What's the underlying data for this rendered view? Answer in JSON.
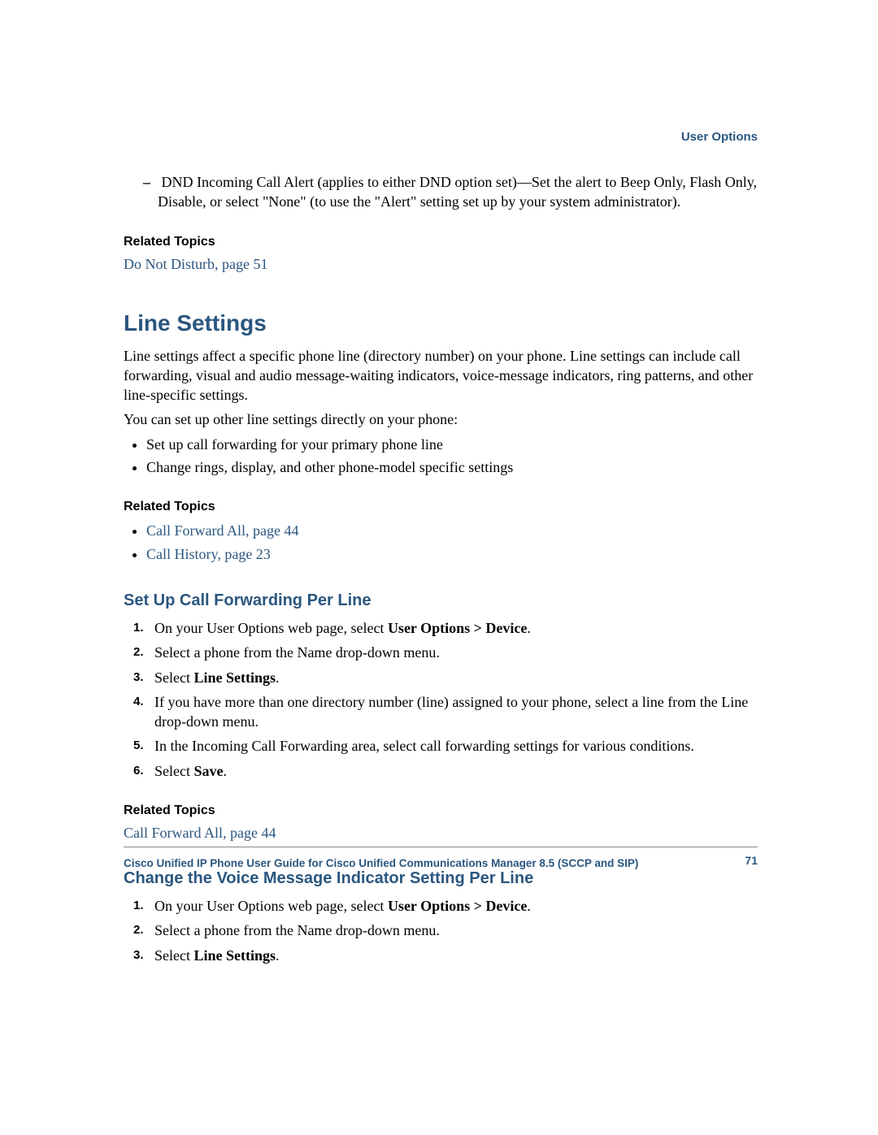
{
  "header": {
    "section_label": "User Options"
  },
  "dnd_item": {
    "prefix": "DND Incoming Call Alert (applies to either DND option set)—Set the alert to Beep Only, Flash Only, Disable, or select \"None\" (to use the \"Alert\" setting set up by your system administrator)."
  },
  "related1": {
    "heading": "Related Topics",
    "link": "Do Not Disturb, page 51"
  },
  "line_settings": {
    "title": "Line Settings",
    "p1": "Line settings affect a specific phone line (directory number) on your phone. Line settings can include call forwarding, visual and audio message-waiting indicators, voice-message indicators, ring patterns, and other line-specific settings.",
    "p2": "You can set up other line settings directly on your phone:",
    "bullets": [
      "Set up call forwarding for your primary phone line",
      "Change rings, display, and other phone-model specific settings"
    ],
    "related": {
      "heading": "Related Topics",
      "links": [
        "Call Forward All, page 44",
        "Call History, page 23"
      ]
    }
  },
  "setup_cf": {
    "title": "Set Up Call Forwarding Per Line",
    "steps": [
      {
        "pre": "On your User Options web page, select ",
        "bold": "User Options > Device",
        "post": "."
      },
      {
        "pre": "Select a phone from the Name drop-down menu.",
        "bold": "",
        "post": ""
      },
      {
        "pre": "Select ",
        "bold": "Line Settings",
        "post": "."
      },
      {
        "pre": "If you have more than one directory number (line) assigned to your phone, select a line from the Line drop-down menu.",
        "bold": "",
        "post": ""
      },
      {
        "pre": "In the Incoming Call Forwarding area, select call forwarding settings for various conditions.",
        "bold": "",
        "post": ""
      },
      {
        "pre": "Select ",
        "bold": "Save",
        "post": "."
      }
    ],
    "related": {
      "heading": "Related Topics",
      "link": "Call Forward All, page 44"
    }
  },
  "change_vmi": {
    "title": "Change the Voice Message Indicator Setting Per Line",
    "steps": [
      {
        "pre": "On your User Options web page, select ",
        "bold": "User Options > Device",
        "post": "."
      },
      {
        "pre": "Select a phone from the Name drop-down menu.",
        "bold": "",
        "post": ""
      },
      {
        "pre": "Select ",
        "bold": "Line Settings",
        "post": "."
      }
    ]
  },
  "footer": {
    "title": "Cisco Unified IP Phone User Guide for Cisco Unified Communications Manager 8.5 (SCCP and SIP)",
    "page": "71"
  }
}
